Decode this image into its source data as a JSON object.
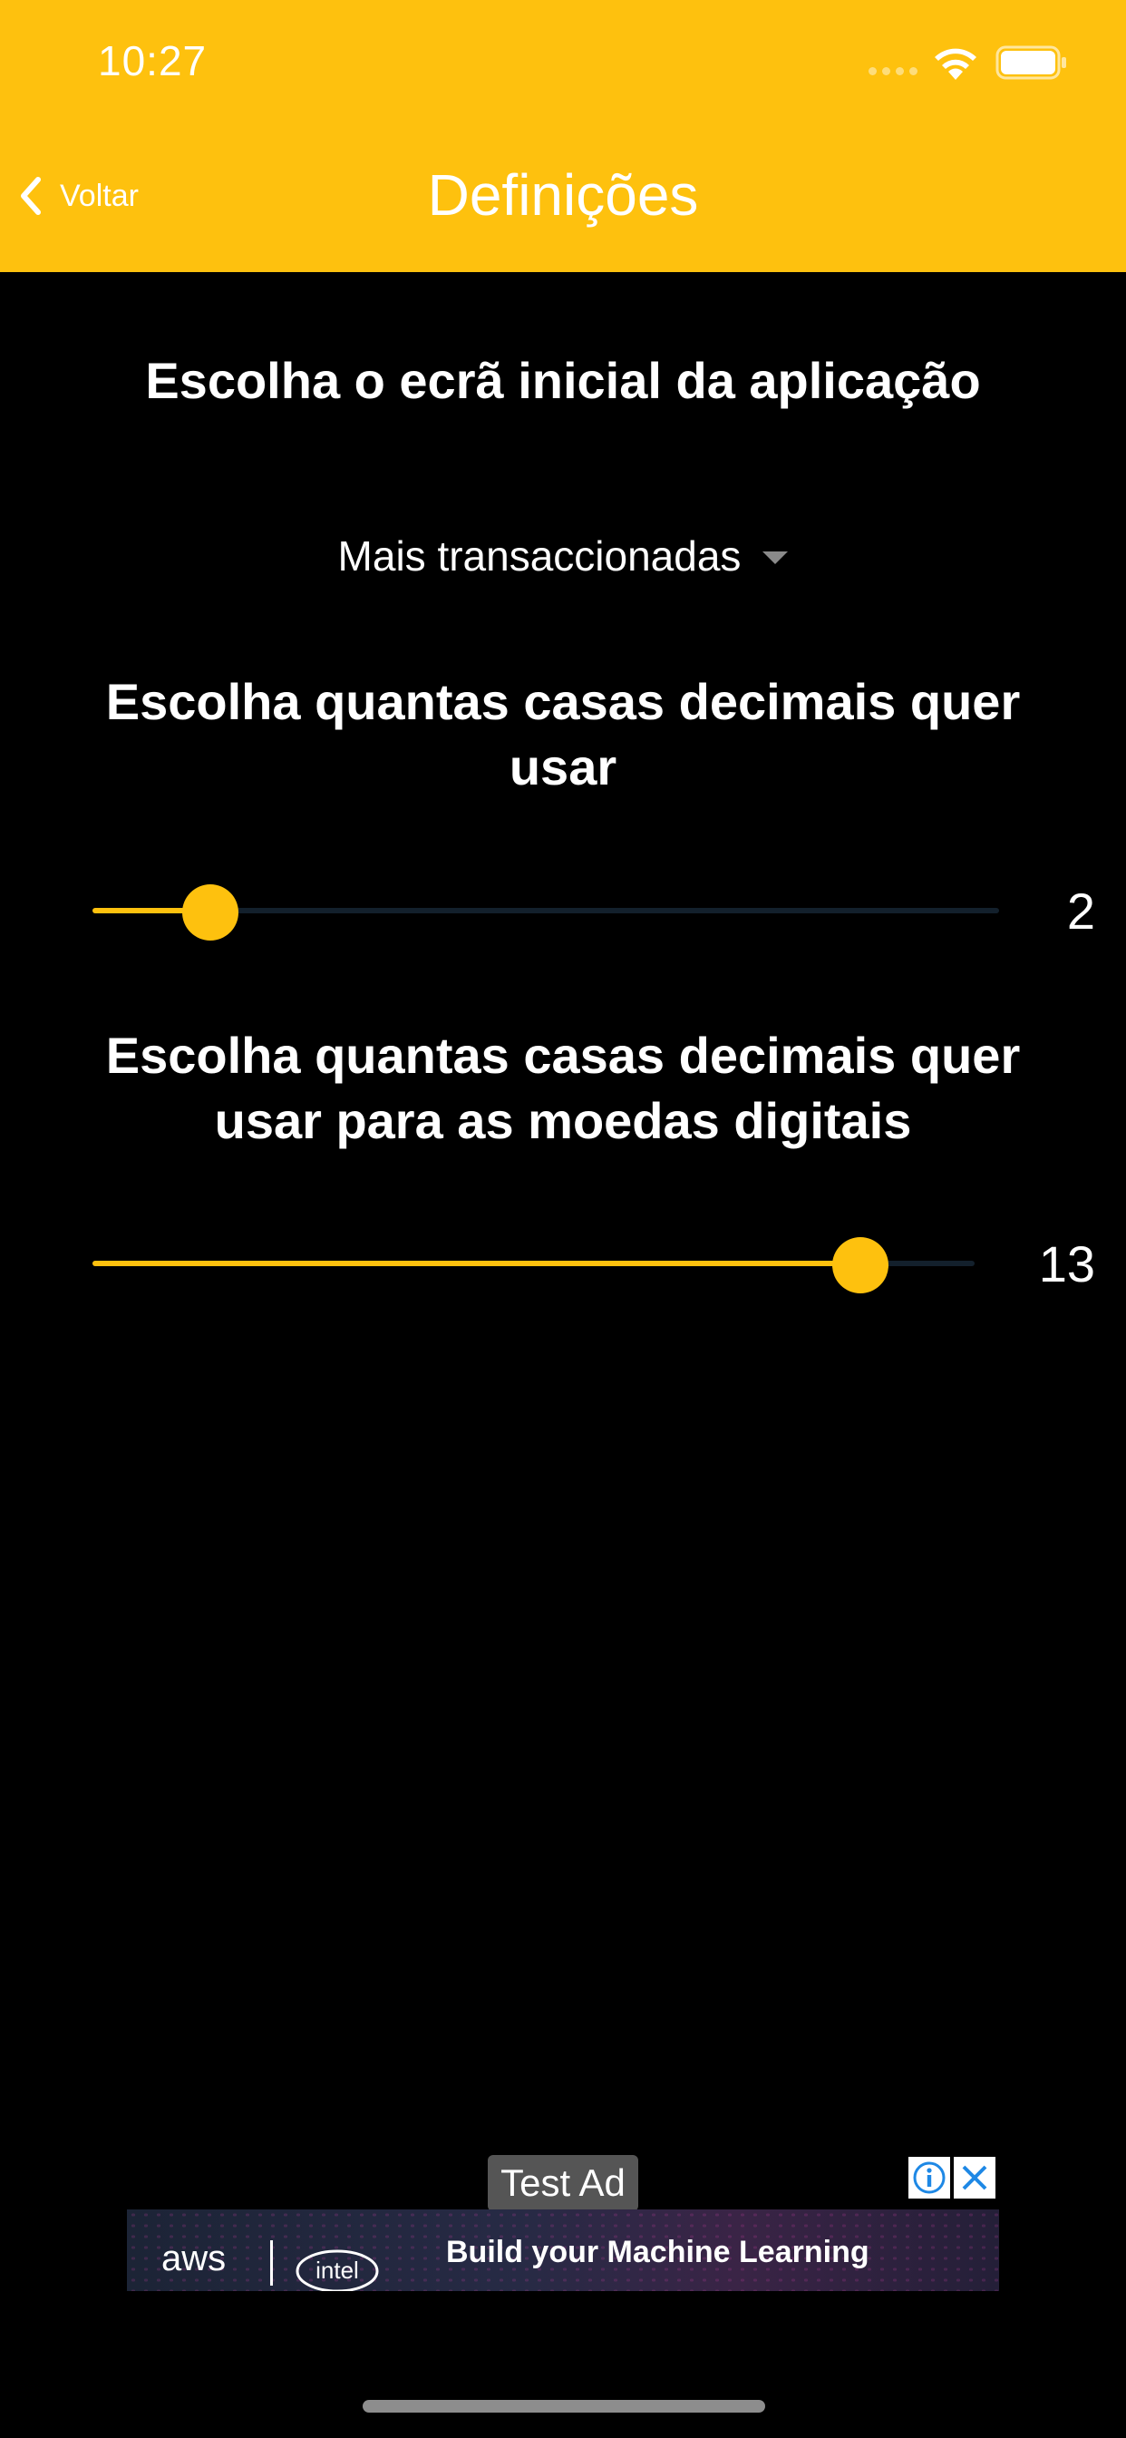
{
  "status_bar": {
    "time": "10:27"
  },
  "nav": {
    "back_label": "Voltar",
    "title": "Definições"
  },
  "settings": {
    "home_screen": {
      "heading": "Escolha o ecrã inicial da aplicação",
      "selected_value": "Mais transaccionadas"
    },
    "decimals": {
      "heading": "Escolha quantas casas decimais quer usar",
      "value": "2",
      "fraction": 0.13
    },
    "crypto_decimals": {
      "heading": "Escolha quantas casas decimais quer usar para as moedas digitais",
      "value": "13",
      "fraction": 0.87
    }
  },
  "ad": {
    "label": "Test Ad",
    "brand_aws": "aws",
    "brand_intel": "intel",
    "headline": "Build your Machine Learning"
  },
  "colors": {
    "accent": "#FEC10E",
    "background": "#000000",
    "track": "#13202C"
  },
  "icons": [
    "chevron-left-icon",
    "signal-icon",
    "wifi-icon",
    "battery-icon",
    "caret-down-icon",
    "info-icon",
    "close-icon"
  ]
}
